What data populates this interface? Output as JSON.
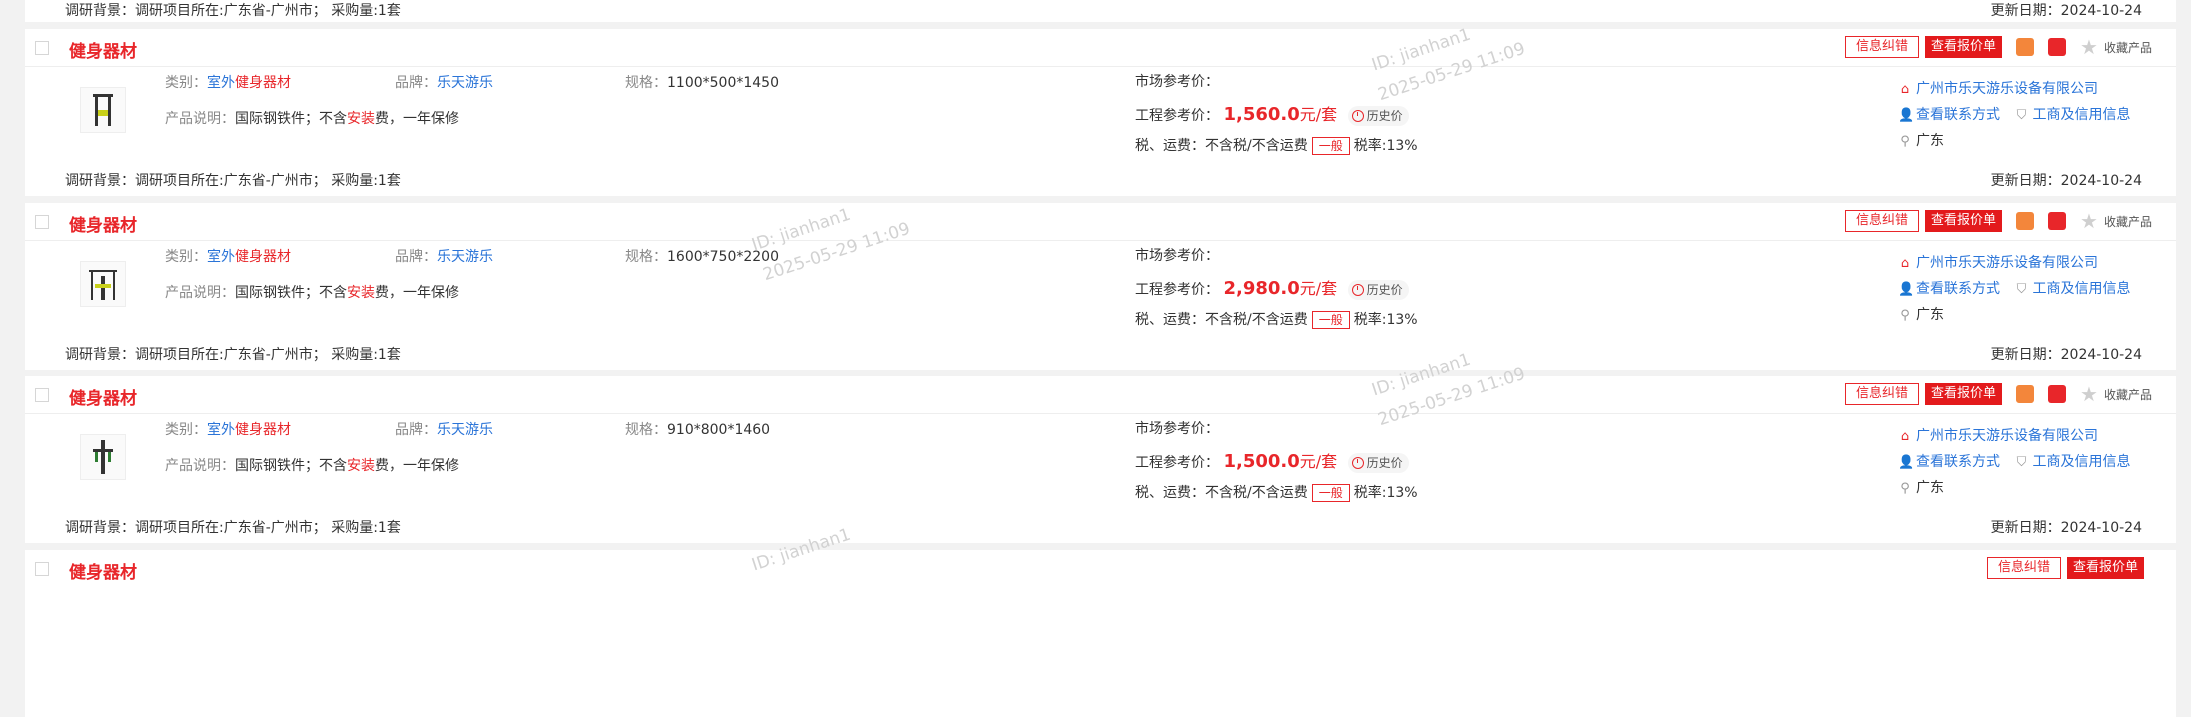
{
  "top_partial": {
    "background": "调研背景：调研项目所在:广东省-广州市；   采购量:1套",
    "date_label": "更新日期：",
    "date_value": "2024-10-24"
  },
  "labels": {
    "category": "类别：",
    "brand": "品牌：",
    "spec": "规格：",
    "description": "产品说明：",
    "market_ref": "市场参考价：",
    "project_ref": "工程参考价：",
    "tax": "税、运费：",
    "tax_value": "不含税/不含运费",
    "badge": "一般",
    "tax_rate": "税率:13%",
    "history": "历史价",
    "error_btn": "信息纠错",
    "quote_btn": "查看报价单",
    "favorite": "收藏产品",
    "contact": "查看联系方式",
    "credit": "工商及信用信息",
    "update_label": "更新日期：",
    "desc_part1": "国际钢铁件；不含",
    "desc_part2": "安装",
    "desc_part3": "费，一年保修",
    "cat_part1": "室外",
    "cat_part2": "健身器材"
  },
  "items": [
    {
      "title": "健身器材",
      "brand": "乐天游乐",
      "spec": "1100*500*1450",
      "price": "1,560.0",
      "unit": "元/套",
      "supplier": "广州市乐天游乐设备有限公司",
      "region": "广东",
      "background": "调研背景：调研项目所在:广东省-广州市；   采购量:1套",
      "update_date": "2024-10-24"
    },
    {
      "title": "健身器材",
      "brand": "乐天游乐",
      "spec": "1600*750*2200",
      "price": "2,980.0",
      "unit": "元/套",
      "supplier": "广州市乐天游乐设备有限公司",
      "region": "广东",
      "background": "调研背景：调研项目所在:广东省-广州市；   采购量:1套",
      "update_date": "2024-10-24"
    },
    {
      "title": "健身器材",
      "brand": "乐天游乐",
      "spec": "910*800*1460",
      "price": "1,500.0",
      "unit": "元/套",
      "supplier": "广州市乐天游乐设备有限公司",
      "region": "广东",
      "background": "调研背景：调研项目所在:广东省-广州市；   采购量:1套",
      "update_date": "2024-10-24"
    }
  ],
  "bottom_partial": {
    "title": "健身器材",
    "error_btn": "信息纠错",
    "quote_btn": "查看报价单"
  },
  "watermarks": {
    "user": "ID: jianhan1",
    "time": "2025-05-29 11:09"
  },
  "colors": {
    "accent": "#e8262a",
    "link": "#2a74d8",
    "orange_icon": "#f3863b"
  }
}
